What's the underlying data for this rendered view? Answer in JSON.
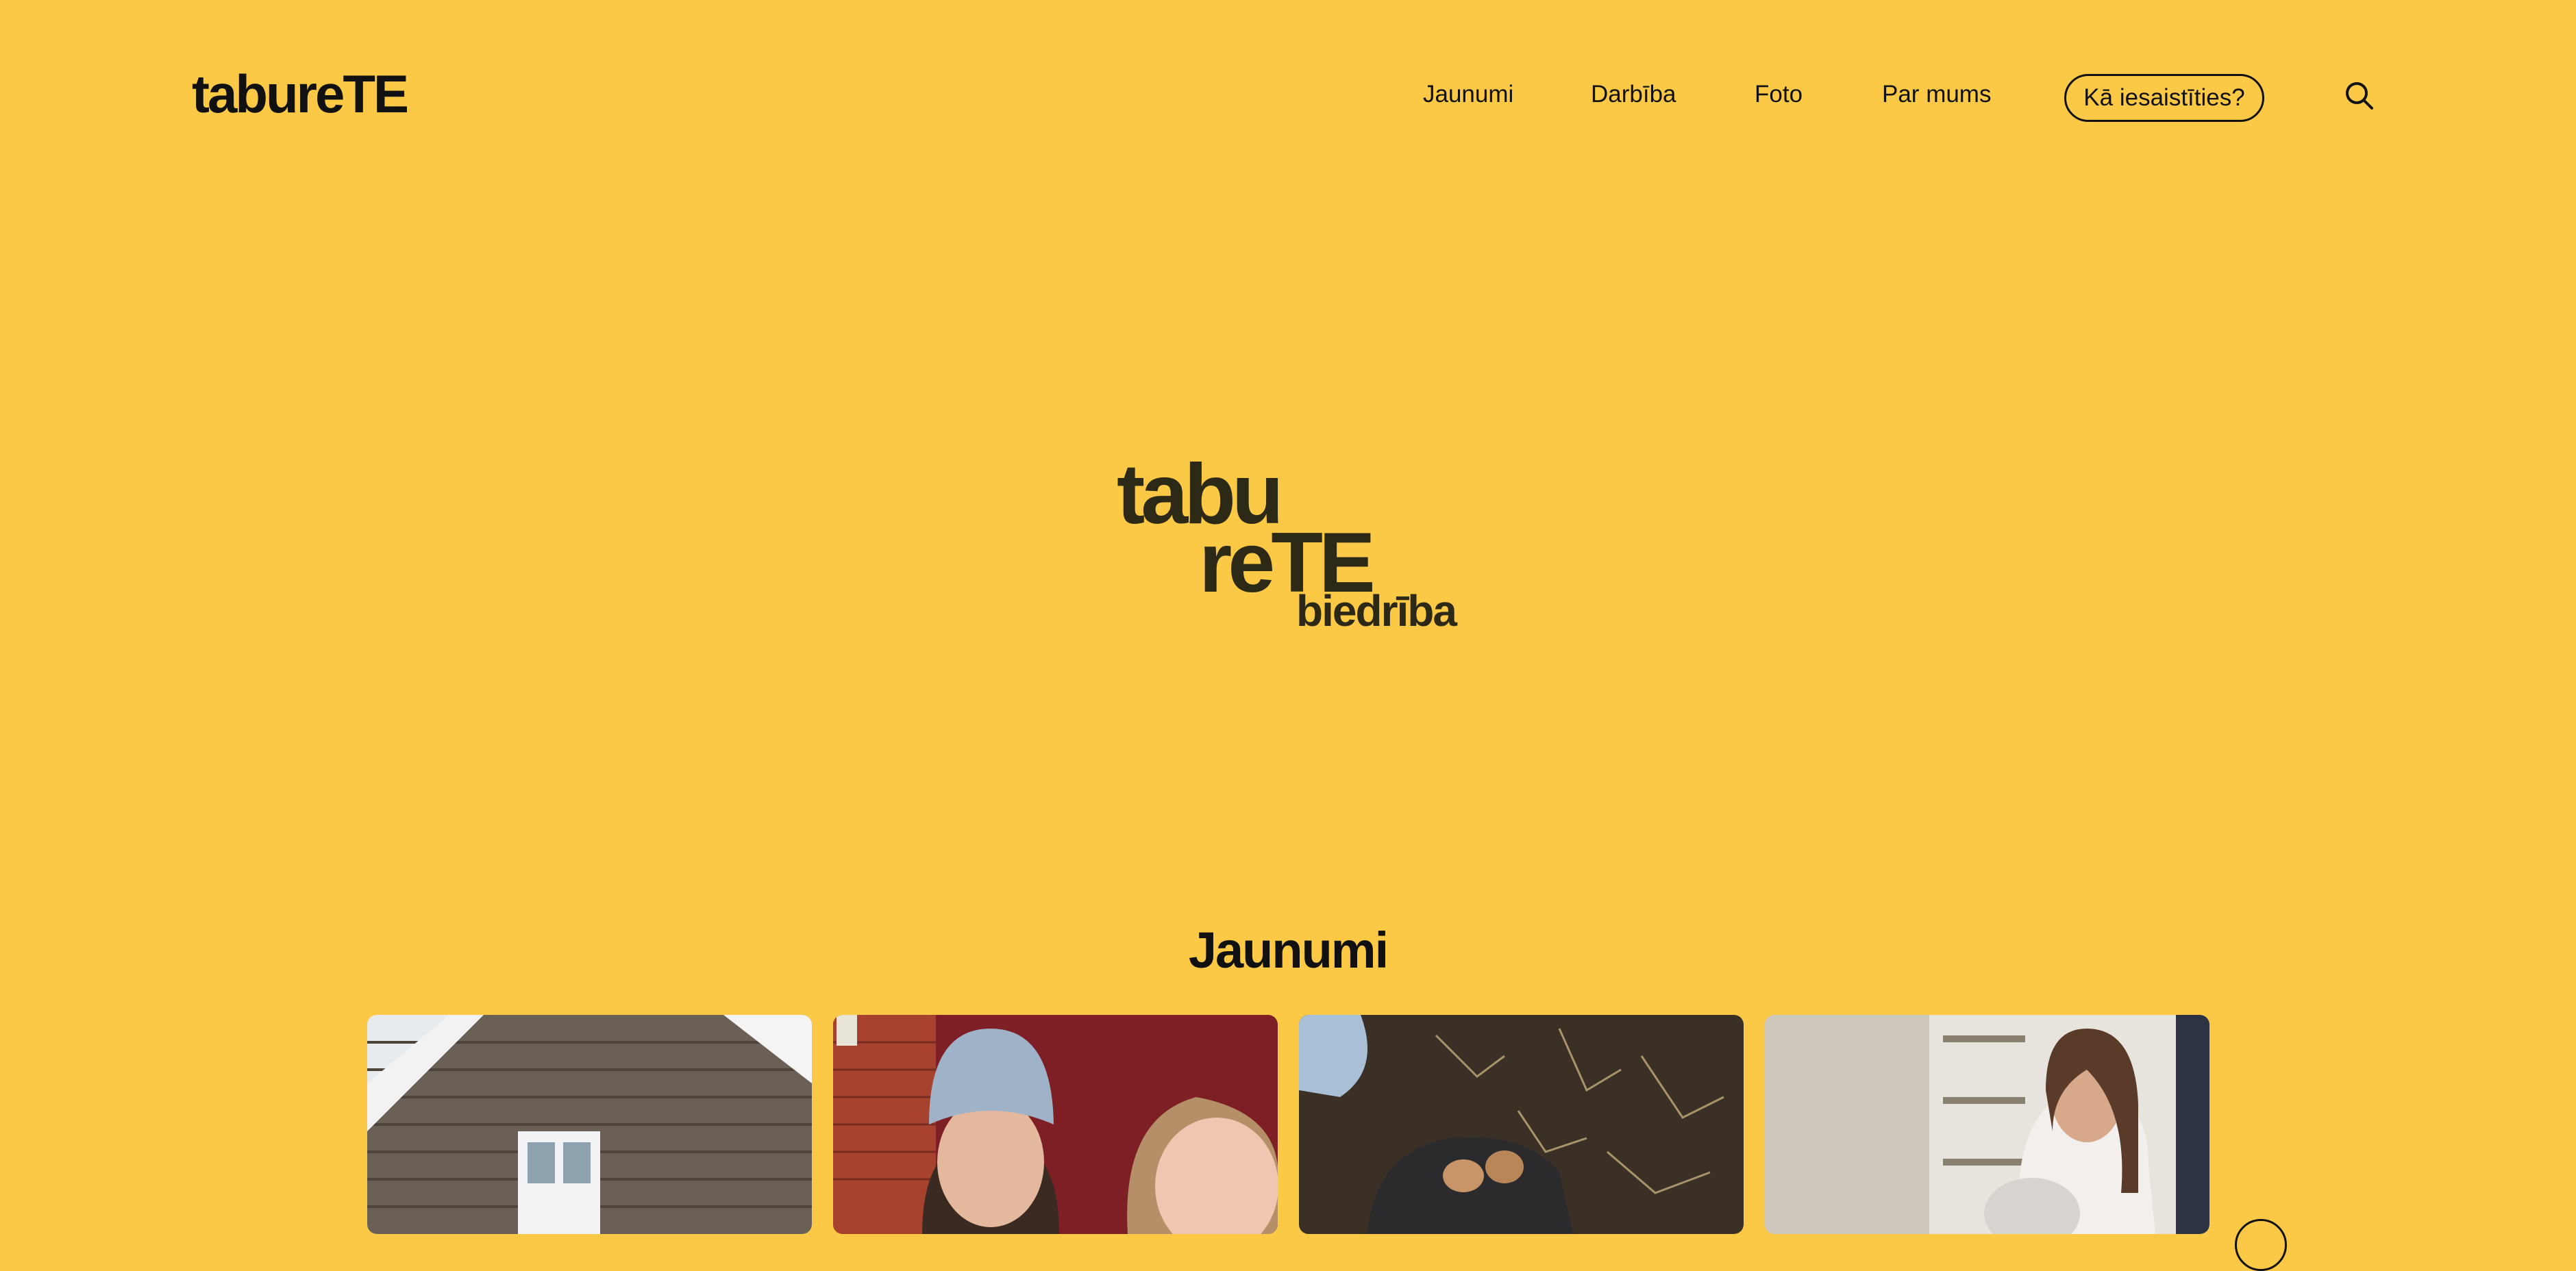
{
  "header": {
    "brand": "tabureTE",
    "nav": [
      {
        "label": "Jaunumi"
      },
      {
        "label": "Darbība"
      },
      {
        "label": "Foto"
      },
      {
        "label": "Par mums"
      }
    ],
    "cta_label": "Kā iesaistīties?",
    "search_icon": "search-icon"
  },
  "hero": {
    "logo_line1": "tabu",
    "logo_line2": "reTE",
    "logo_line3": "biedrība"
  },
  "news": {
    "title": "Jaunumi",
    "cards": [
      {
        "image": "wooden-house-photo"
      },
      {
        "image": "two-women-photo"
      },
      {
        "image": "gloved-hand-potatoes-photo"
      },
      {
        "image": "girl-with-grandmother-photo"
      }
    ]
  },
  "colors": {
    "background": "#FCC946",
    "text": "#111111",
    "logo": "#2C2A16"
  }
}
